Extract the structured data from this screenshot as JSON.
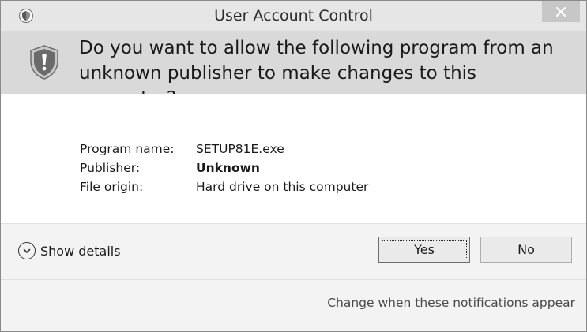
{
  "window": {
    "title": "User Account Control",
    "close_label": "✕"
  },
  "header": {
    "question": "Do you want to allow the following program from an unknown publisher to make changes to this computer?"
  },
  "details": {
    "program_name_label": "Program name:",
    "program_name_value": "SETUP81E.exe",
    "publisher_label": "Publisher:",
    "publisher_value": "Unknown",
    "file_origin_label": "File origin:",
    "file_origin_value": "Hard drive on this computer"
  },
  "actions": {
    "show_details_label": "Show details",
    "yes_label": "Yes",
    "no_label": "No"
  },
  "footer": {
    "link_label": "Change when these notifications appear"
  },
  "icons": {
    "title_icon": "uac-shield-icon",
    "header_icon": "warning-shield-icon",
    "close_icon": "close-icon",
    "details_icon": "chevron-down-circle-icon"
  },
  "colors": {
    "titlebar": "#e6e6e6",
    "header": "#d9d9d9",
    "body": "#ffffff",
    "footer": "#f3f3f3",
    "close_button": "#c7c7c7"
  }
}
